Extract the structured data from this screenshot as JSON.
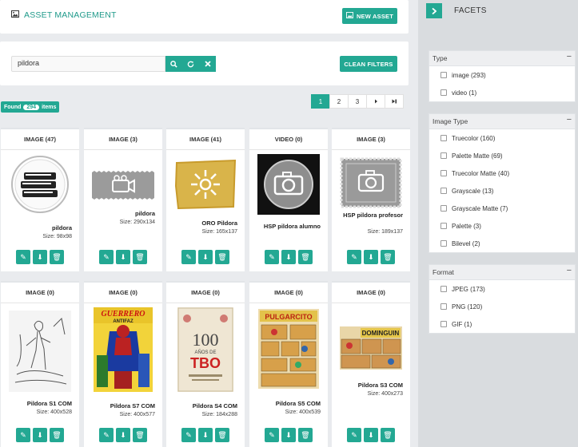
{
  "header": {
    "title": "ASSET MANAGEMENT",
    "new_asset_label": "NEW ASSET"
  },
  "search": {
    "value": "pildora",
    "clean_filters_label": "CLEAN FILTERS"
  },
  "results": {
    "found_label": "Found",
    "count": "294",
    "items_label": "items"
  },
  "pagination": {
    "pages": [
      "1",
      "2",
      "3"
    ],
    "next": "›",
    "last": "⏭",
    "active": "1"
  },
  "cards": [
    {
      "title": "IMAGE (47)",
      "name": "pildora",
      "size": "Size: 98x98",
      "icon": "books-icon"
    },
    {
      "title": "IMAGE (3)",
      "name": "pildora",
      "size": "Size: 290x134",
      "icon": "video-camera-icon"
    },
    {
      "title": "IMAGE (41)",
      "name": "ORO Pildora",
      "size": "Size: 165x137",
      "icon": "gold-badge-icon"
    },
    {
      "title": "VIDEO (0)",
      "name": "HSP pildora alumno",
      "size": "",
      "icon": "camera-icon"
    },
    {
      "title": "IMAGE (3)",
      "name": "HSP pildora profesor",
      "size": "Size: 189x137",
      "icon": "camera-stamp-icon"
    },
    {
      "title": "IMAGE (0)",
      "name": "Pildora S1 COM",
      "size": "Size: 400x528",
      "icon": "sketch-image"
    },
    {
      "title": "IMAGE (0)",
      "name": "Pildora S7 COM",
      "size": "Size: 400x577",
      "icon": "comic-cover-image"
    },
    {
      "title": "IMAGE (0)",
      "name": "Pildora S4 COM",
      "size": "Size: 184x288",
      "icon": "book-cover-image"
    },
    {
      "title": "IMAGE (0)",
      "name": "Pildora S5 COM",
      "size": "Size: 400x539",
      "icon": "comic-page-image"
    },
    {
      "title": "IMAGE (0)",
      "name": "Pildora S3 COM",
      "size": "Size: 400x273",
      "icon": "comic-strip-image"
    }
  ],
  "thumb_text": {
    "card7_top": "GUERRERO",
    "card7_sub": "ANTIFAZ",
    "card8_big": "100",
    "card8_mid": "AÑOS DE",
    "card8_tbo": "TBO",
    "card9_top": "PULGARCITO",
    "card10_top": "DOMINGUIN"
  },
  "facets": {
    "label": "FACETS",
    "groups": [
      {
        "title": "Type",
        "options": [
          "image (293)",
          "video (1)"
        ]
      },
      {
        "title": "Image Type",
        "options": [
          "Truecolor (160)",
          "Palette Matte (69)",
          "Truecolor Matte (40)",
          "Grayscale (13)",
          "Grayscale Matte (7)",
          "Palette (3)",
          "Bilevel (2)"
        ]
      },
      {
        "title": "Format",
        "options": [
          "JPEG (173)",
          "PNG (120)",
          "GIF (1)"
        ]
      }
    ]
  },
  "colors": {
    "accent": "#23a893",
    "accent_text": "#1f9a8a",
    "background": "#e9ebee",
    "facet_panel": "#d9dcdf"
  }
}
